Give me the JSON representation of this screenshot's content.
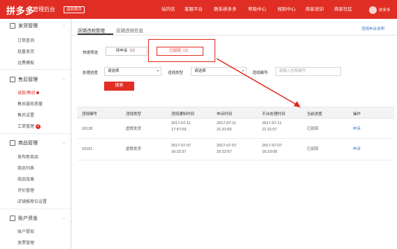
{
  "topbar": {
    "logo": "拼多多",
    "subtitle": "管理后台",
    "back_home": "返回首页",
    "nav": [
      "站内信",
      "客服平台",
      "联系拼多多",
      "帮助中心",
      "规则中心",
      "商家培训",
      "商家社区"
    ],
    "username": "拼多多"
  },
  "sidebar": {
    "sections": [
      {
        "title": "发货管理",
        "icon": "delivery-icon",
        "items": [
          "订单查询",
          "批量发货",
          "运费模板"
        ]
      },
      {
        "title": "售后管理",
        "icon": "after-sale-icon",
        "items": [
          "退款/售后",
          "售后服务质量",
          "售后设置",
          "工单管理"
        ]
      },
      {
        "title": "商品管理",
        "icon": "goods-icon",
        "items": [
          "发布新商品",
          "商品列表",
          "商品效果",
          "评价管理",
          "店铺推荐位设置"
        ]
      },
      {
        "title": "账户资金",
        "icon": "account-icon",
        "items": [
          "账户提现",
          "发票管理"
        ]
      }
    ],
    "ticket_badge": "2"
  },
  "main": {
    "tabs": [
      "店铺违规管理",
      "店铺违规信息"
    ],
    "help_link": "违规申诉说明",
    "filters": {
      "quick_label": "快速筛选",
      "pending_label": "待申诉",
      "pending_count": "0",
      "rejected_label": "已驳回",
      "rejected_count": "2",
      "progress_label": "处理进度",
      "progress_value": "请选择",
      "type_label": "违规类型",
      "type_value": "请选择",
      "no_label": "违规编号:",
      "no_placeholder": "请输入违规编号",
      "search_button": "搜索"
    },
    "table": {
      "columns": [
        "违规编号",
        "违规类型",
        "违规通知时间",
        "申诉时间",
        "平台处理时间",
        "当前进度",
        "操作"
      ],
      "rows": [
        {
          "id": "10128",
          "type": "虚假发货",
          "notice_date": "2017-07-11",
          "notice_time": "17:47:09",
          "appeal_date": "2017-07-11",
          "appeal_time": "21:31:00",
          "handle_date": "2017-07-11",
          "handle_time": "21:31:57",
          "status": "已驳回",
          "action": "申诉"
        },
        {
          "id": "10101",
          "type": "虚假发货",
          "notice_date": "2017-07-07",
          "notice_time": "16:22:37",
          "appeal_date": "2017-07-07",
          "appeal_time": "16:22:57",
          "handle_date": "2017-07-07",
          "handle_time": "16:23:08",
          "status": "已驳回",
          "action": "申诉"
        }
      ]
    }
  },
  "colors": {
    "brand": "#e02e24",
    "link": "#3a79c8"
  }
}
